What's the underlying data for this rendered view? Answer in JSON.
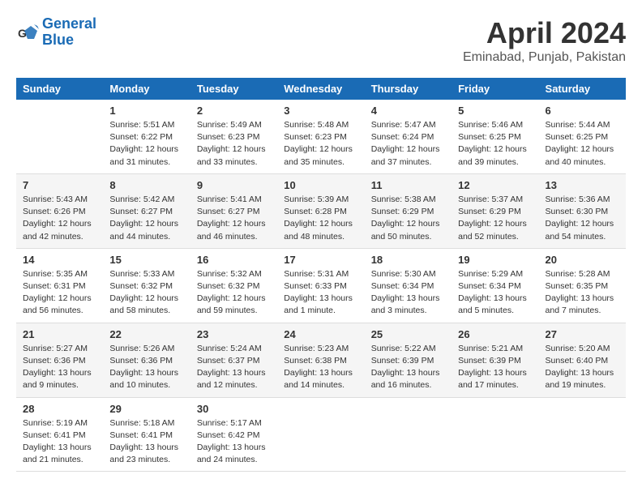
{
  "logo": {
    "line1": "General",
    "line2": "Blue"
  },
  "title": "April 2024",
  "location": "Eminabad, Punjab, Pakistan",
  "header_days": [
    "Sunday",
    "Monday",
    "Tuesday",
    "Wednesday",
    "Thursday",
    "Friday",
    "Saturday"
  ],
  "weeks": [
    [
      {
        "day": "",
        "info": ""
      },
      {
        "day": "1",
        "info": "Sunrise: 5:51 AM\nSunset: 6:22 PM\nDaylight: 12 hours\nand 31 minutes."
      },
      {
        "day": "2",
        "info": "Sunrise: 5:49 AM\nSunset: 6:23 PM\nDaylight: 12 hours\nand 33 minutes."
      },
      {
        "day": "3",
        "info": "Sunrise: 5:48 AM\nSunset: 6:23 PM\nDaylight: 12 hours\nand 35 minutes."
      },
      {
        "day": "4",
        "info": "Sunrise: 5:47 AM\nSunset: 6:24 PM\nDaylight: 12 hours\nand 37 minutes."
      },
      {
        "day": "5",
        "info": "Sunrise: 5:46 AM\nSunset: 6:25 PM\nDaylight: 12 hours\nand 39 minutes."
      },
      {
        "day": "6",
        "info": "Sunrise: 5:44 AM\nSunset: 6:25 PM\nDaylight: 12 hours\nand 40 minutes."
      }
    ],
    [
      {
        "day": "7",
        "info": "Sunrise: 5:43 AM\nSunset: 6:26 PM\nDaylight: 12 hours\nand 42 minutes."
      },
      {
        "day": "8",
        "info": "Sunrise: 5:42 AM\nSunset: 6:27 PM\nDaylight: 12 hours\nand 44 minutes."
      },
      {
        "day": "9",
        "info": "Sunrise: 5:41 AM\nSunset: 6:27 PM\nDaylight: 12 hours\nand 46 minutes."
      },
      {
        "day": "10",
        "info": "Sunrise: 5:39 AM\nSunset: 6:28 PM\nDaylight: 12 hours\nand 48 minutes."
      },
      {
        "day": "11",
        "info": "Sunrise: 5:38 AM\nSunset: 6:29 PM\nDaylight: 12 hours\nand 50 minutes."
      },
      {
        "day": "12",
        "info": "Sunrise: 5:37 AM\nSunset: 6:29 PM\nDaylight: 12 hours\nand 52 minutes."
      },
      {
        "day": "13",
        "info": "Sunrise: 5:36 AM\nSunset: 6:30 PM\nDaylight: 12 hours\nand 54 minutes."
      }
    ],
    [
      {
        "day": "14",
        "info": "Sunrise: 5:35 AM\nSunset: 6:31 PM\nDaylight: 12 hours\nand 56 minutes."
      },
      {
        "day": "15",
        "info": "Sunrise: 5:33 AM\nSunset: 6:32 PM\nDaylight: 12 hours\nand 58 minutes."
      },
      {
        "day": "16",
        "info": "Sunrise: 5:32 AM\nSunset: 6:32 PM\nDaylight: 12 hours\nand 59 minutes."
      },
      {
        "day": "17",
        "info": "Sunrise: 5:31 AM\nSunset: 6:33 PM\nDaylight: 13 hours\nand 1 minute."
      },
      {
        "day": "18",
        "info": "Sunrise: 5:30 AM\nSunset: 6:34 PM\nDaylight: 13 hours\nand 3 minutes."
      },
      {
        "day": "19",
        "info": "Sunrise: 5:29 AM\nSunset: 6:34 PM\nDaylight: 13 hours\nand 5 minutes."
      },
      {
        "day": "20",
        "info": "Sunrise: 5:28 AM\nSunset: 6:35 PM\nDaylight: 13 hours\nand 7 minutes."
      }
    ],
    [
      {
        "day": "21",
        "info": "Sunrise: 5:27 AM\nSunset: 6:36 PM\nDaylight: 13 hours\nand 9 minutes."
      },
      {
        "day": "22",
        "info": "Sunrise: 5:26 AM\nSunset: 6:36 PM\nDaylight: 13 hours\nand 10 minutes."
      },
      {
        "day": "23",
        "info": "Sunrise: 5:24 AM\nSunset: 6:37 PM\nDaylight: 13 hours\nand 12 minutes."
      },
      {
        "day": "24",
        "info": "Sunrise: 5:23 AM\nSunset: 6:38 PM\nDaylight: 13 hours\nand 14 minutes."
      },
      {
        "day": "25",
        "info": "Sunrise: 5:22 AM\nSunset: 6:39 PM\nDaylight: 13 hours\nand 16 minutes."
      },
      {
        "day": "26",
        "info": "Sunrise: 5:21 AM\nSunset: 6:39 PM\nDaylight: 13 hours\nand 17 minutes."
      },
      {
        "day": "27",
        "info": "Sunrise: 5:20 AM\nSunset: 6:40 PM\nDaylight: 13 hours\nand 19 minutes."
      }
    ],
    [
      {
        "day": "28",
        "info": "Sunrise: 5:19 AM\nSunset: 6:41 PM\nDaylight: 13 hours\nand 21 minutes."
      },
      {
        "day": "29",
        "info": "Sunrise: 5:18 AM\nSunset: 6:41 PM\nDaylight: 13 hours\nand 23 minutes."
      },
      {
        "day": "30",
        "info": "Sunrise: 5:17 AM\nSunset: 6:42 PM\nDaylight: 13 hours\nand 24 minutes."
      },
      {
        "day": "",
        "info": ""
      },
      {
        "day": "",
        "info": ""
      },
      {
        "day": "",
        "info": ""
      },
      {
        "day": "",
        "info": ""
      }
    ]
  ]
}
